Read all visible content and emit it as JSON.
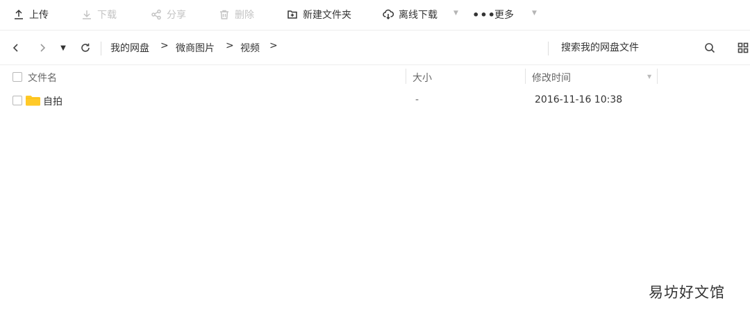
{
  "toolbar": {
    "upload": {
      "label": "上传",
      "icon": "upload-icon"
    },
    "download": {
      "label": "下载",
      "icon": "download-icon"
    },
    "share": {
      "label": "分享",
      "icon": "share-icon"
    },
    "delete": {
      "label": "删除",
      "icon": "trash-icon"
    },
    "new_folder": {
      "label": "新建文件夹",
      "icon": "new-folder-icon"
    },
    "offline_download": {
      "label": "离线下载",
      "icon": "cloud-download-icon"
    },
    "more": {
      "label": "更多",
      "icon": "more-dots-icon"
    }
  },
  "nav": {
    "breadcrumb": [
      "我的网盘",
      "微商图片",
      "视频"
    ],
    "crumb_separator": ">",
    "search_placeholder": "搜索我的网盘文件"
  },
  "table": {
    "columns": {
      "name": "文件名",
      "size": "大小",
      "modified": "修改时间"
    },
    "rows": [
      {
        "name": "自拍",
        "size": "-",
        "modified": "2016-11-16 10:38",
        "type": "folder"
      }
    ]
  },
  "colors": {
    "folder": "#FFC928",
    "disabled_text": "#c3c3c3"
  },
  "watermark": "易坊好文馆"
}
